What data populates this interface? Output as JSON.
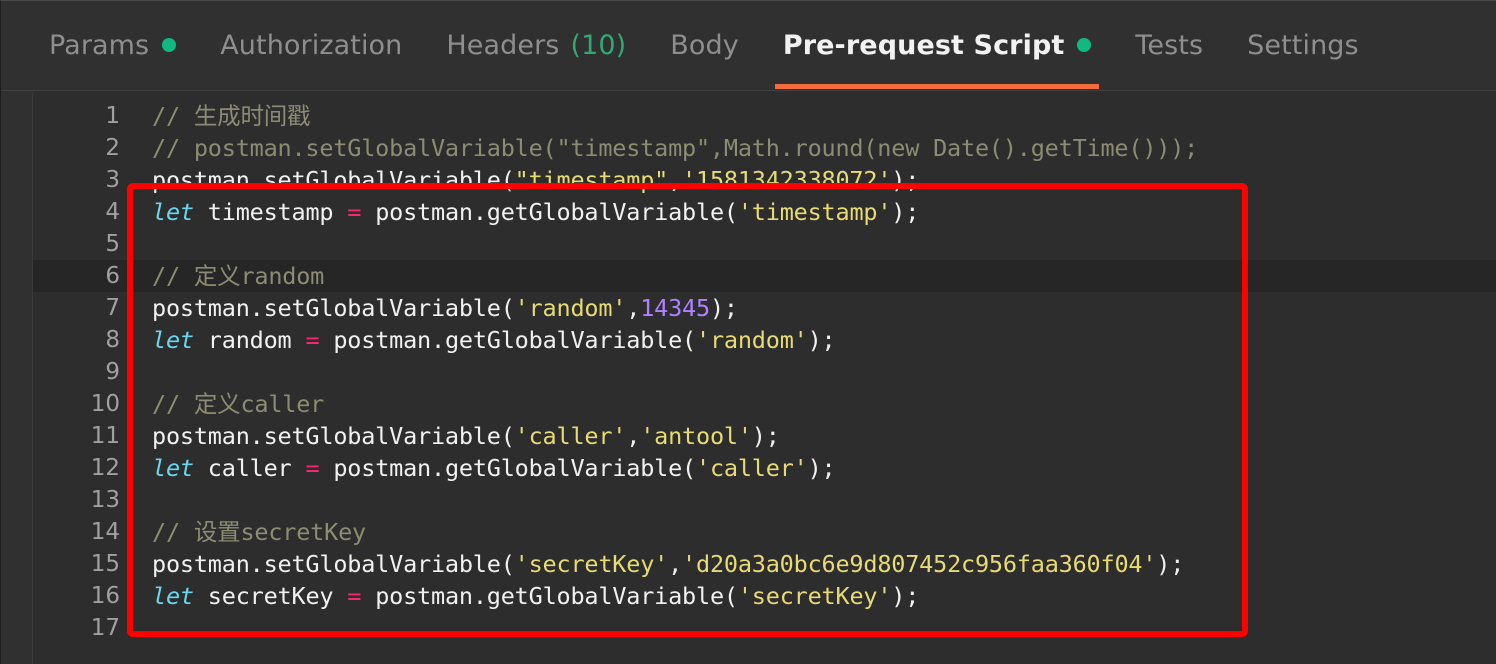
{
  "tabs": [
    {
      "label": "Params",
      "badge_dot": true,
      "count": "",
      "active": false,
      "name": "tab-params"
    },
    {
      "label": "Authorization",
      "badge_dot": false,
      "count": "",
      "active": false,
      "name": "tab-authorization"
    },
    {
      "label": "Headers",
      "badge_dot": false,
      "count": "(10)",
      "active": false,
      "name": "tab-headers"
    },
    {
      "label": "Body",
      "badge_dot": false,
      "count": "",
      "active": false,
      "name": "tab-body"
    },
    {
      "label": "Pre-request Script",
      "badge_dot": true,
      "count": "",
      "active": true,
      "name": "tab-pre-request-script"
    },
    {
      "label": "Tests",
      "badge_dot": false,
      "count": "",
      "active": false,
      "name": "tab-tests"
    },
    {
      "label": "Settings",
      "badge_dot": false,
      "count": "",
      "active": false,
      "name": "tab-settings"
    }
  ],
  "colors": {
    "accent_underline": "#f26b3a",
    "status_dot": "#10b981",
    "count_text": "#2faa74",
    "annotation_box": "#ff0000",
    "editor_bg": "#2d2d2d",
    "panel_bg": "#303030",
    "active_line_bg": "#262626"
  },
  "editor": {
    "active_line": 6,
    "lines": [
      {
        "n": "1",
        "tokens": [
          {
            "t": "comment",
            "v": "// 生成时间戳"
          }
        ]
      },
      {
        "n": "2",
        "tokens": [
          {
            "t": "comment",
            "v": "// postman.setGlobalVariable(\"timestamp\",Math.round(new Date().getTime()));"
          }
        ]
      },
      {
        "n": "3",
        "tokens": [
          {
            "t": "plain",
            "v": "postman.setGlobalVariable("
          },
          {
            "t": "str",
            "v": "\"timestamp\""
          },
          {
            "t": "plain",
            "v": ","
          },
          {
            "t": "str",
            "v": "'1581342338072'"
          },
          {
            "t": "plain",
            "v": ");"
          }
        ]
      },
      {
        "n": "4",
        "tokens": [
          {
            "t": "kw",
            "v": "let"
          },
          {
            "t": "plain",
            "v": " timestamp "
          },
          {
            "t": "op",
            "v": "="
          },
          {
            "t": "plain",
            "v": " postman.getGlobalVariable("
          },
          {
            "t": "str",
            "v": "'timestamp'"
          },
          {
            "t": "plain",
            "v": ");"
          }
        ]
      },
      {
        "n": "5",
        "tokens": []
      },
      {
        "n": "6",
        "tokens": [
          {
            "t": "comment",
            "v": "// 定义random"
          }
        ]
      },
      {
        "n": "7",
        "tokens": [
          {
            "t": "plain",
            "v": "postman.setGlobalVariable("
          },
          {
            "t": "str",
            "v": "'random'"
          },
          {
            "t": "plain",
            "v": ","
          },
          {
            "t": "num",
            "v": "14345"
          },
          {
            "t": "plain",
            "v": ");"
          }
        ]
      },
      {
        "n": "8",
        "tokens": [
          {
            "t": "kw",
            "v": "let"
          },
          {
            "t": "plain",
            "v": " random "
          },
          {
            "t": "op",
            "v": "="
          },
          {
            "t": "plain",
            "v": " postman.getGlobalVariable("
          },
          {
            "t": "str",
            "v": "'random'"
          },
          {
            "t": "plain",
            "v": ");"
          }
        ]
      },
      {
        "n": "9",
        "tokens": []
      },
      {
        "n": "10",
        "tokens": [
          {
            "t": "comment",
            "v": "// 定义caller"
          }
        ]
      },
      {
        "n": "11",
        "tokens": [
          {
            "t": "plain",
            "v": "postman.setGlobalVariable("
          },
          {
            "t": "str",
            "v": "'caller'"
          },
          {
            "t": "plain",
            "v": ","
          },
          {
            "t": "str",
            "v": "'antool'"
          },
          {
            "t": "plain",
            "v": ");"
          }
        ]
      },
      {
        "n": "12",
        "tokens": [
          {
            "t": "kw",
            "v": "let"
          },
          {
            "t": "plain",
            "v": " caller "
          },
          {
            "t": "op",
            "v": "="
          },
          {
            "t": "plain",
            "v": " postman.getGlobalVariable("
          },
          {
            "t": "str",
            "v": "'caller'"
          },
          {
            "t": "plain",
            "v": ");"
          }
        ]
      },
      {
        "n": "13",
        "tokens": []
      },
      {
        "n": "14",
        "tokens": [
          {
            "t": "comment",
            "v": "// 设置secretKey"
          }
        ]
      },
      {
        "n": "15",
        "tokens": [
          {
            "t": "plain",
            "v": "postman.setGlobalVariable("
          },
          {
            "t": "str",
            "v": "'secretKey'"
          },
          {
            "t": "plain",
            "v": ","
          },
          {
            "t": "str",
            "v": "'d20a3a0bc6e9d807452c956faa360f04'"
          },
          {
            "t": "plain",
            "v": ");"
          }
        ]
      },
      {
        "n": "16",
        "tokens": [
          {
            "t": "kw",
            "v": "let"
          },
          {
            "t": "plain",
            "v": " secretKey "
          },
          {
            "t": "op",
            "v": "="
          },
          {
            "t": "plain",
            "v": " postman.getGlobalVariable("
          },
          {
            "t": "str",
            "v": "'secretKey'"
          },
          {
            "t": "plain",
            "v": ");"
          }
        ]
      },
      {
        "n": "17",
        "tokens": []
      }
    ]
  }
}
